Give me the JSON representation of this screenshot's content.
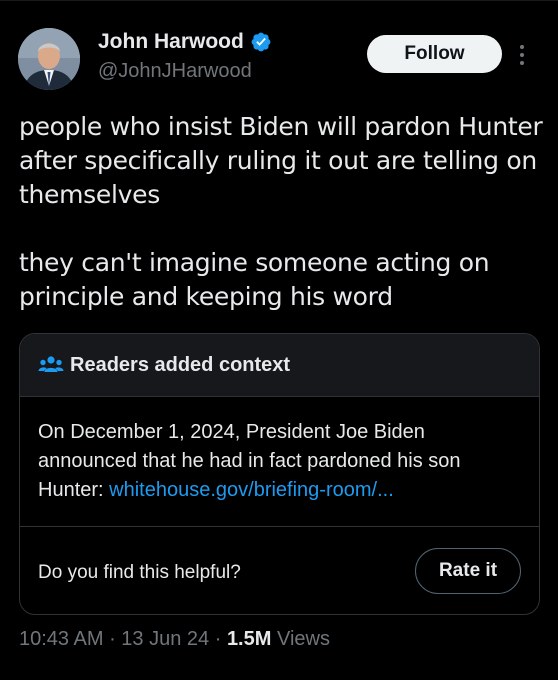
{
  "author": {
    "name": "John Harwood",
    "handle": "@JohnJHarwood",
    "verified": true,
    "avatar_icon": "profile-photo"
  },
  "actions": {
    "follow_label": "Follow",
    "more_icon": "more-vertical-icon"
  },
  "tweet": {
    "paragraphs": [
      "people who insist Biden will pardon Hunter after specifically ruling it out are telling on themselves",
      "they can't imagine someone acting on principle and keeping his word"
    ]
  },
  "community_note": {
    "title": "Readers added context",
    "icon": "people-icon",
    "body": "On December 1, 2024, President Joe Biden announced that he had in fact pardoned his son Hunter: ",
    "link_text": "whitehouse.gov/briefing-room/...",
    "helpful_question": "Do you find this helpful?",
    "rate_label": "Rate it"
  },
  "meta": {
    "time": "10:43 AM",
    "date": "13 Jun 24",
    "separator": " · ",
    "views_count": "1.5M",
    "views_label": " Views"
  },
  "colors": {
    "background": "#000000",
    "text": "#e7e9ea",
    "secondary": "#71767b",
    "link": "#1d9bf0",
    "verified": "#1d9bf0",
    "border": "#2f3336"
  }
}
